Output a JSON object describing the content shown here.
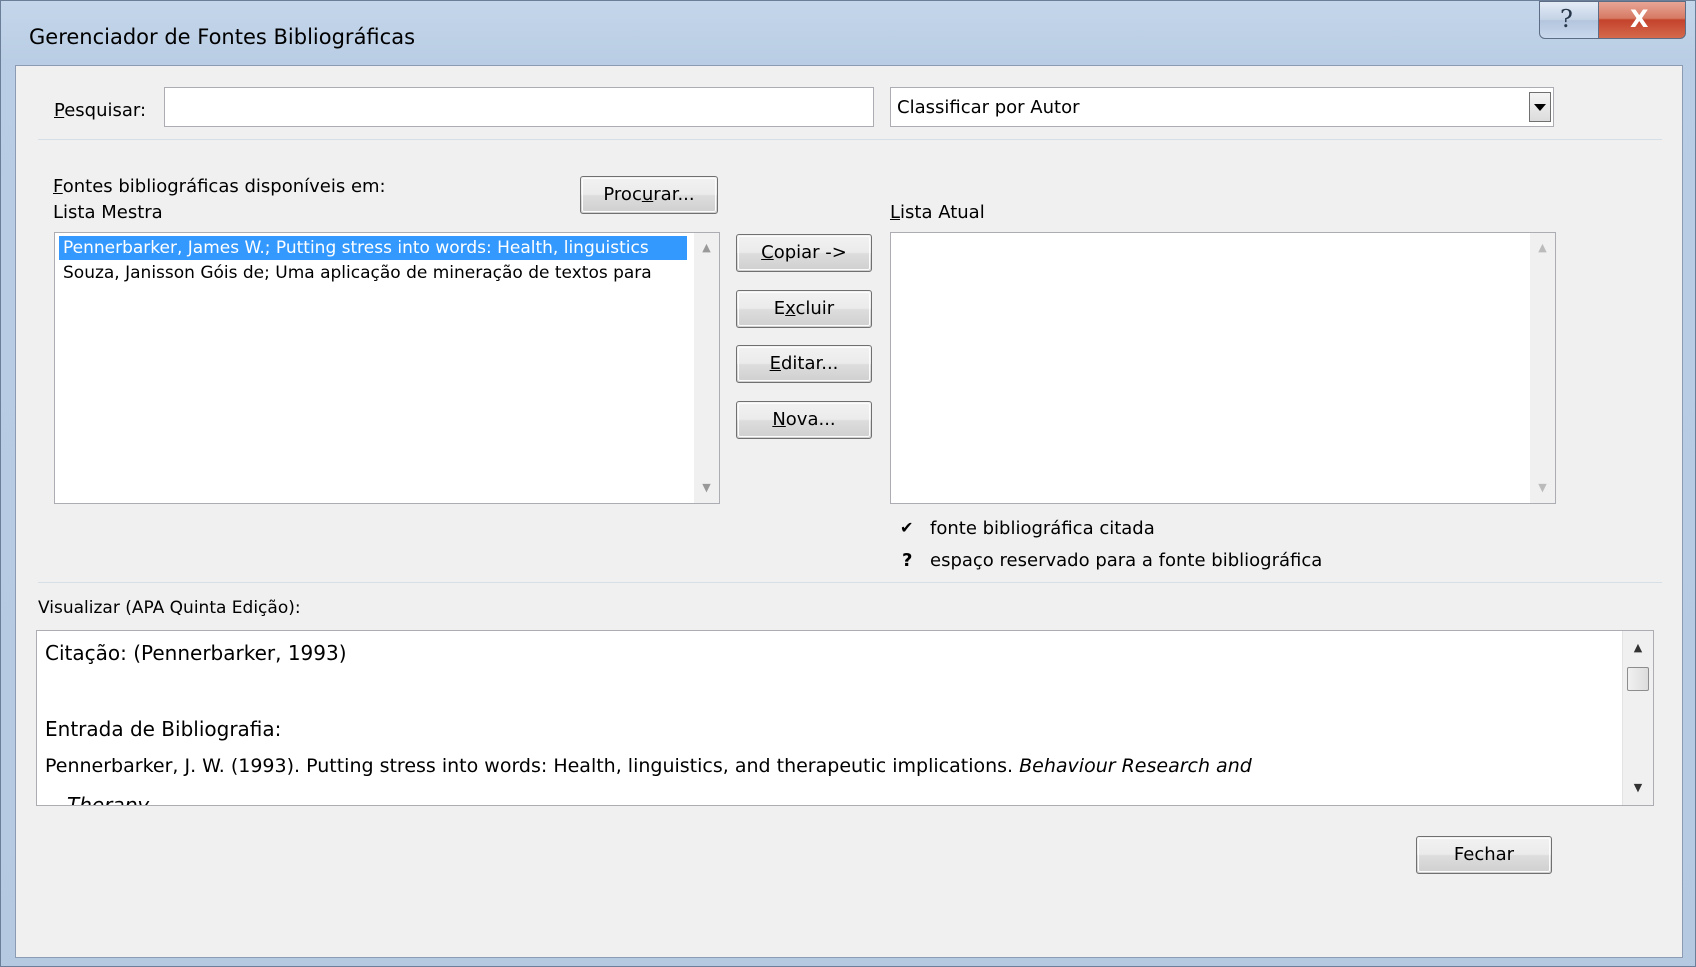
{
  "window": {
    "title": "Gerenciador de Fontes Bibliográficas",
    "help_glyph": "?",
    "close_glyph": "X"
  },
  "search": {
    "label_prefix": "",
    "label_mnemonic": "P",
    "label_rest": "esquisar:",
    "value": ""
  },
  "sort": {
    "selected": "Classificar por Autor"
  },
  "master": {
    "heading_mnemonic": "F",
    "heading_rest": "ontes bibliográficas disponíveis em:",
    "list_label": "Lista Mestra",
    "browse_prefix": "Proc",
    "browse_mnemonic": "u",
    "browse_rest": "rar...",
    "items": [
      "Pennerbarker, James W.; Putting stress into words: Health, linguistics",
      "Souza, Janisson Góis de; Uma aplicação de mineração de textos para"
    ]
  },
  "actions": {
    "copy_mnemonic": "C",
    "copy_rest": "opiar ->",
    "delete_prefix": "E",
    "delete_mnemonic": "x",
    "delete_rest": "cluir",
    "edit_mnemonic": "E",
    "edit_rest": "ditar...",
    "new_mnemonic": "N",
    "new_rest": "ova..."
  },
  "current": {
    "label_mnemonic": "L",
    "label_rest": "ista Atual",
    "items": []
  },
  "legend": {
    "cited_symbol": "✔",
    "cited_text": "fonte bibliográfica citada",
    "placeholder_symbol": "?",
    "placeholder_text": "espaço reservado para a fonte bibliográfica"
  },
  "preview": {
    "label": "Visualizar (APA Quinta Edição):",
    "citation": "Citação:  (Pennerbarker, 1993)",
    "bib_heading": "Entrada de Bibliografia:",
    "bib_entry_plain": "Pennerbarker, J. W. (1993). Putting stress into words: Health, linguistics, and therapeutic implications. ",
    "bib_entry_italic": "Behaviour Research and",
    "bib_entry_cont": "Therapy"
  },
  "footer": {
    "close_label": "Fechar"
  }
}
